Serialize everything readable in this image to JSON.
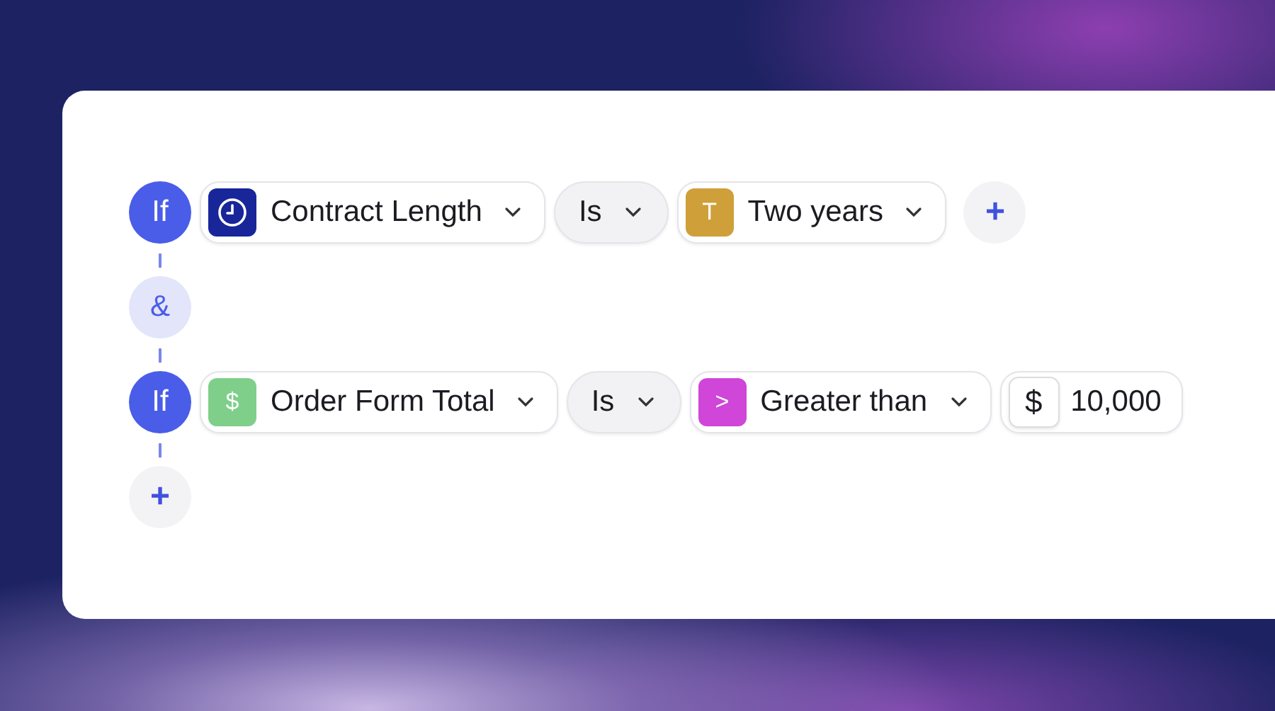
{
  "conditions": [
    {
      "keyword": "If",
      "chips": [
        {
          "kind": "field",
          "color": "#18269a",
          "label": "Contract Length"
        },
        {
          "kind": "operator",
          "label": "Is"
        },
        {
          "kind": "value",
          "badge": "T",
          "color": "#cf9f3a",
          "label": "Two years"
        }
      ],
      "add_button": "+"
    },
    {
      "keyword": "If",
      "chips": [
        {
          "kind": "field",
          "badge": "$",
          "color": "#7fcf8a",
          "label": "Order Form Total"
        },
        {
          "kind": "operator",
          "label": "Is"
        },
        {
          "kind": "value",
          "badge": ">",
          "color": "#cf46d8",
          "label": "Greater than"
        },
        {
          "kind": "amount",
          "prefix": "$",
          "value": "10,000"
        }
      ]
    }
  ],
  "joins": [
    "&"
  ],
  "add_condition": "+"
}
